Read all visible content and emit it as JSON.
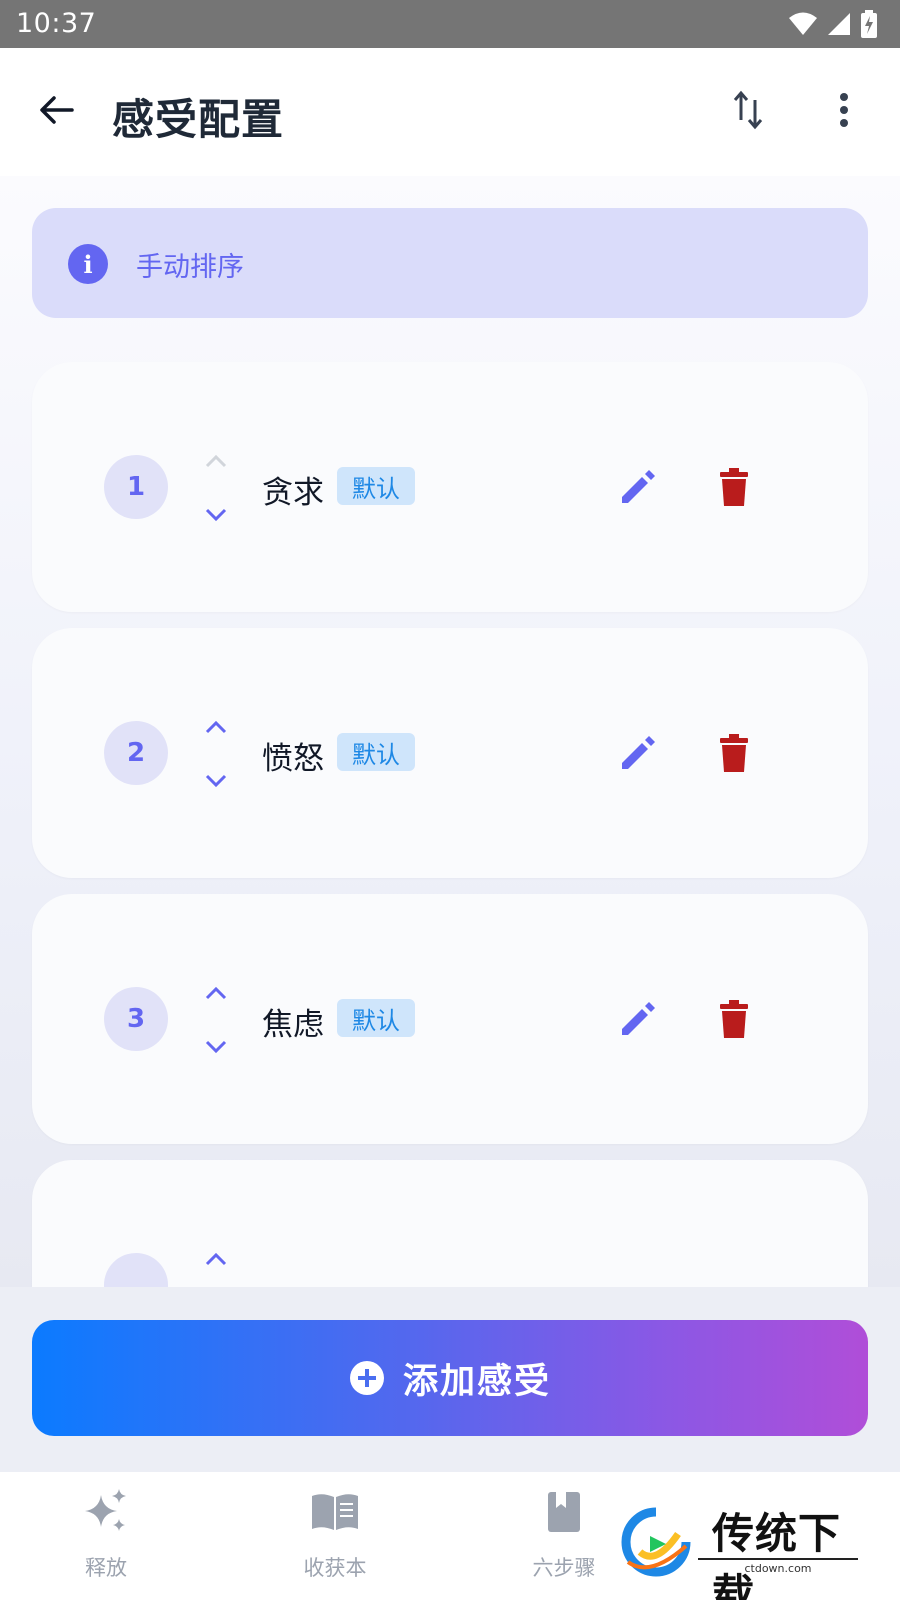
{
  "status": {
    "time": "10:37"
  },
  "header": {
    "title": "感受配置"
  },
  "banner": {
    "text": "手动排序"
  },
  "feelings": [
    {
      "index": "1",
      "name": "贪求",
      "tag": "默认",
      "up_disabled": true
    },
    {
      "index": "2",
      "name": "愤怒",
      "tag": "默认",
      "up_disabled": false
    },
    {
      "index": "3",
      "name": "焦虑",
      "tag": "默认",
      "up_disabled": false
    }
  ],
  "add_button": {
    "label": "添加感受"
  },
  "nav": {
    "items": [
      {
        "label": "释放",
        "icon": "sparkles-icon"
      },
      {
        "label": "收获本",
        "icon": "book-icon"
      },
      {
        "label": "六步骤",
        "icon": "bookmark-book-icon"
      }
    ]
  },
  "watermark": {
    "text": "传统下载",
    "sub": "ctdown.com"
  },
  "colors": {
    "accent": "#6366f1",
    "delete": "#b91c1c",
    "tag_bg": "#cfe5fb",
    "tag_text": "#1e88e5"
  }
}
